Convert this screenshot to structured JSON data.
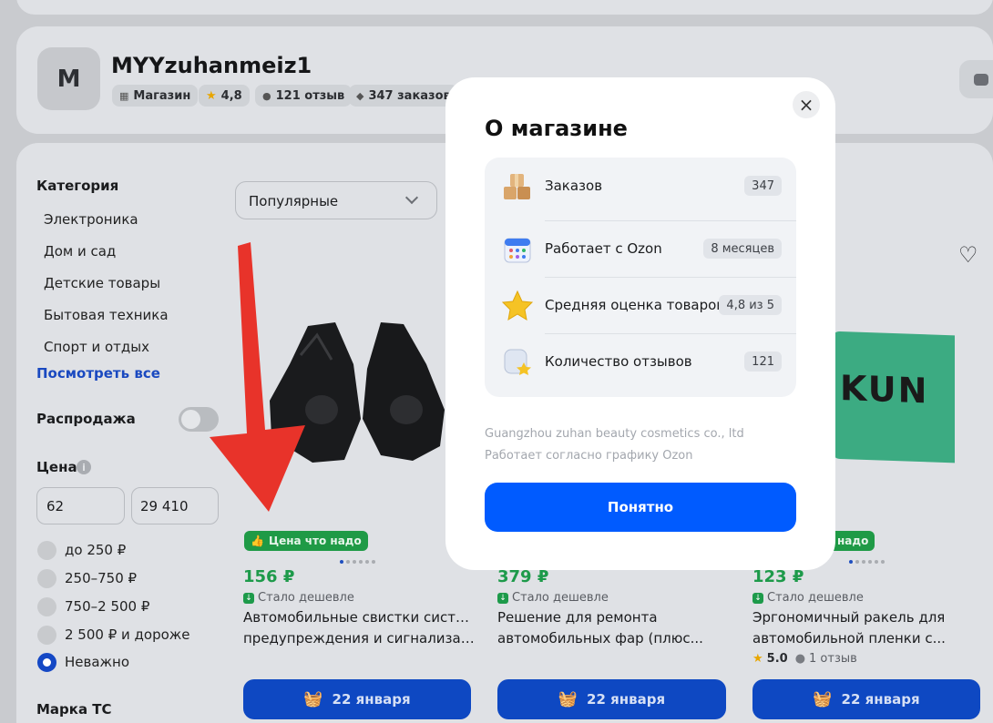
{
  "seller": {
    "avatar_letter": "M",
    "name": "MYYzuhanmeiz1",
    "chips": [
      {
        "icon": "shop-icon",
        "label": "Магазин"
      },
      {
        "icon": "star-icon",
        "label": "4,8"
      },
      {
        "icon": "comment-icon",
        "label": "121 отзыв"
      },
      {
        "icon": "box-icon",
        "label": "347 заказов"
      }
    ]
  },
  "filters": {
    "category_heading": "Категория",
    "categories": [
      "Электроника",
      "Дом и сад",
      "Детские товары",
      "Бытовая техника",
      "Спорт и отдых"
    ],
    "see_all": "Посмотреть все",
    "sale_label": "Распродажа",
    "price_heading": "Цена",
    "price_from": "62",
    "price_to": "29 410",
    "price_options": [
      "до 250 ₽",
      "250–750 ₽",
      "750–2 500 ₽",
      "2 500 ₽ и дороже",
      "Неважно"
    ],
    "selected_price_option": "Неважно",
    "brand_heading": "Марка ТС"
  },
  "sort": {
    "selected": "Популярные"
  },
  "products": [
    {
      "badge": "Цена что надо",
      "price": "156 ₽",
      "cheaper": "Стало дешевле",
      "title_line1": "Автомобильные свистки система",
      "title_line2": "предупреждения и сигнализаци...",
      "delivery": "22 января"
    },
    {
      "price": "379 ₽",
      "cheaper": "Стало дешевле",
      "title_line1": "Решение для ремонта",
      "title_line2": "автомобильных фар (плюс...",
      "delivery": "22 января"
    },
    {
      "badge": "надо",
      "price": "123 ₽",
      "cheaper": "Стало дешевле",
      "title_line1": "Эргономичный ракель для",
      "title_line2": "автомобильной пленки с...",
      "rating": "5.0",
      "reviews": "1 отзыв",
      "delivery": "22 января"
    }
  ],
  "product3_image_text": "KUN",
  "modal": {
    "title": "О магазине",
    "rows": [
      {
        "icon": "boxes-icon",
        "label": "Заказов",
        "value": "347"
      },
      {
        "icon": "calendar-icon",
        "label": "Работает с Ozon",
        "value": "8 месяцев"
      },
      {
        "icon": "star-icon",
        "label": "Средняя оценка товаров",
        "value": "4,8 из 5"
      },
      {
        "icon": "reviews-icon",
        "label": "Количество отзывов",
        "value": "121"
      }
    ],
    "company": "Guangzhou zuhan beauty cosmetics co., ltd",
    "schedule": "Работает согласно графику Ozon",
    "ok_label": "Понятно"
  },
  "colors": {
    "accent": "#005bff",
    "price_green": "#1d9a4a",
    "arrow": "#e8332a"
  }
}
